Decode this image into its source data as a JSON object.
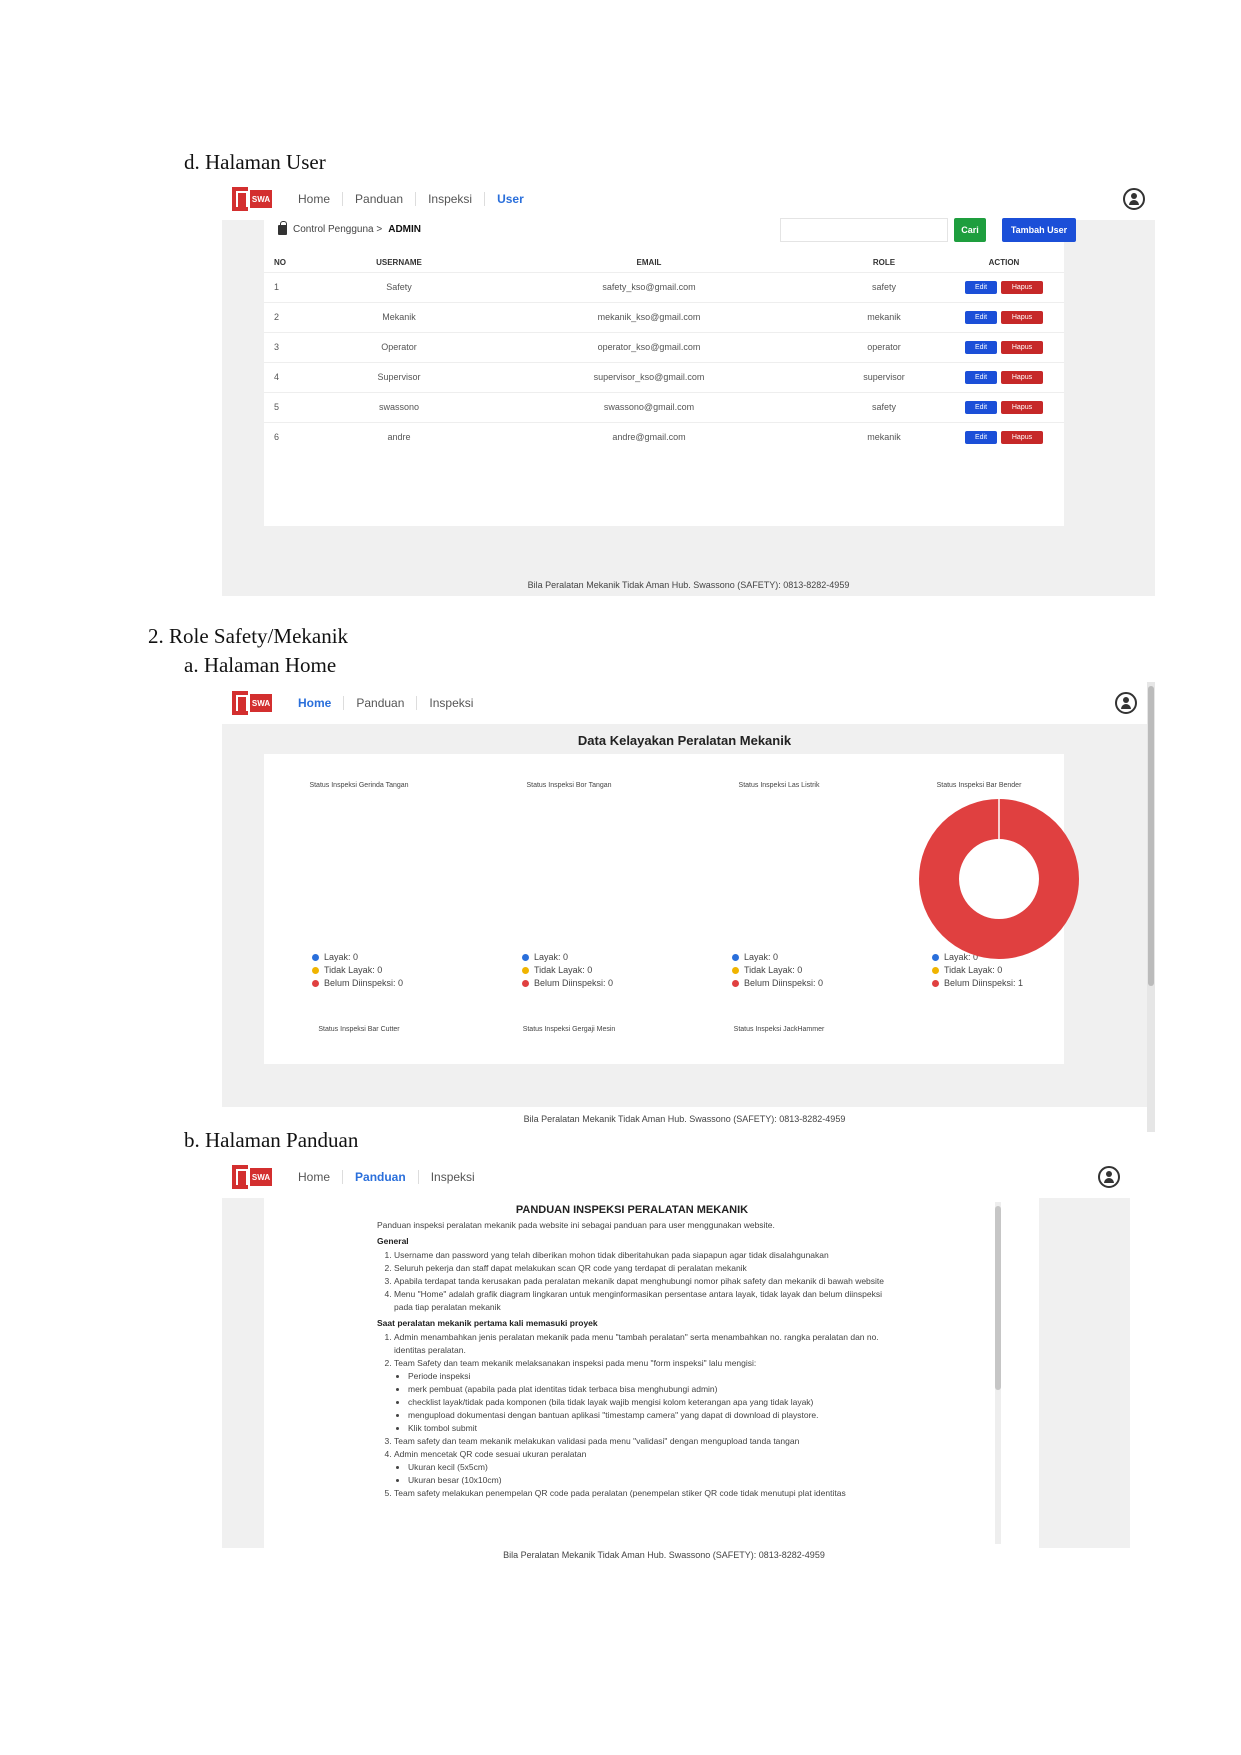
{
  "headings": {
    "d": "d.   Halaman User",
    "role": "2.   Role Safety/Mekanik",
    "a": "a.   Halaman Home",
    "b": "b.   Halaman Panduan"
  },
  "user_page": {
    "nav": [
      "Home",
      "Panduan",
      "Inspeksi",
      "User"
    ],
    "active": "User",
    "logo_text": "SWA",
    "breadcrumb_prefix": "Control Pengguna > ",
    "breadcrumb_current": "ADMIN",
    "search_placeholder": "",
    "cari_label": "Cari",
    "tambah_label": "Tambah User",
    "columns": [
      "NO",
      "USERNAME",
      "EMAIL",
      "ROLE",
      "ACTION"
    ],
    "edit_label": "Edit",
    "hapus_label": "Hapus",
    "rows": [
      {
        "no": "1",
        "username": "Safety",
        "email": "safety_kso@gmail.com",
        "role": "safety"
      },
      {
        "no": "2",
        "username": "Mekanik",
        "email": "mekanik_kso@gmail.com",
        "role": "mekanik"
      },
      {
        "no": "3",
        "username": "Operator",
        "email": "operator_kso@gmail.com",
        "role": "operator"
      },
      {
        "no": "4",
        "username": "Supervisor",
        "email": "supervisor_kso@gmail.com",
        "role": "supervisor"
      },
      {
        "no": "5",
        "username": "swassono",
        "email": "swassono@gmail.com",
        "role": "safety"
      },
      {
        "no": "6",
        "username": "andre",
        "email": "andre@gmail.com",
        "role": "mekanik"
      }
    ],
    "footer": "Bila Peralatan Mekanik Tidak Aman Hub. Swassono (SAFETY): 0813-8282-4959"
  },
  "home_page": {
    "nav": [
      "Home",
      "Panduan",
      "Inspeksi"
    ],
    "active": "Home",
    "title": "Data Kelayakan Peralatan Mekanik",
    "colors": {
      "layak": "#2a6fdb",
      "tidak_layak": "#f0b400",
      "belum": "#e04040"
    },
    "charts": [
      {
        "title": "Status Inspeksi Gerinda Tangan",
        "layak": "Layak: 0",
        "tidak": "Tidak Layak: 0",
        "belum": "Belum Diinspeksi: 0"
      },
      {
        "title": "Status Inspeksi Bor Tangan",
        "layak": "Layak: 0",
        "tidak": "Tidak Layak: 0",
        "belum": "Belum Diinspeksi: 0"
      },
      {
        "title": "Status Inspeksi Las Listrik",
        "layak": "Layak: 0",
        "tidak": "Tidak Layak: 0",
        "belum": "Belum Diinspeksi: 0"
      },
      {
        "title": "Status Inspeksi Bar Bender",
        "layak": "Layak: 0",
        "tidak": "Tidak Layak: 0",
        "belum": "Belum Diinspeksi: 1"
      }
    ],
    "charts_row2": [
      "Status Inspeksi Bar Cutter",
      "Status Inspeksi Gergaji Mesin",
      "Status Inspeksi JackHammer"
    ],
    "footer": "Bila Peralatan Mekanik Tidak Aman Hub. Swassono (SAFETY): 0813-8282-4959"
  },
  "panduan_page": {
    "nav": [
      "Home",
      "Panduan",
      "Inspeksi"
    ],
    "active": "Panduan",
    "title": "PANDUAN INSPEKSI PERALATAN MEKANIK",
    "intro": "Panduan inspeksi peralatan mekanik pada website ini sebagai panduan para user menggunakan website.",
    "general_heading": "General",
    "general": [
      "Username dan password yang telah diberikan mohon tidak diberitahukan pada siapapun agar tidak disalahgunakan",
      "Seluruh pekerja dan staff dapat melakukan scan QR code yang terdapat di peralatan mekanik",
      "Apabila terdapat tanda kerusakan pada peralatan mekanik dapat menghubungi nomor pihak safety dan mekanik di bawah website",
      "Menu \"Home\" adalah grafik diagram lingkaran untuk menginformasikan persentase antara layak, tidak layak dan belum diinspeksi pada tiap peralatan mekanik"
    ],
    "section2_heading": "Saat peralatan mekanik pertama kali memasuki proyek",
    "s2_1": "Admin menambahkan jenis peralatan mekanik pada menu \"tambah peralatan\" serta menambahkan no. rangka peralatan dan no. identitas peralatan.",
    "s2_2": "Team Safety dan team mekanik melaksanakan inspeksi pada menu \"form inspeksi\" lalu mengisi:",
    "s2_2_items": [
      "Periode inspeksi",
      "merk pembuat (apabila pada plat identitas tidak terbaca bisa menghubungi admin)",
      "checklist layak/tidak pada komponen (bila tidak layak wajib mengisi kolom keterangan apa yang tidak layak)",
      "mengupload dokumentasi dengan bantuan aplikasi \"timestamp camera\" yang dapat di download di playstore.",
      "Klik tombol submit"
    ],
    "s2_3": "Team safety dan team mekanik melakukan validasi pada menu \"validasi\" dengan mengupload tanda tangan",
    "s2_4": "Admin mencetak QR code sesuai ukuran peralatan",
    "s2_4_items": [
      "Ukuran kecil (5x5cm)",
      "Ukuran besar (10x10cm)"
    ],
    "s2_5": "Team safety melakukan penempelan QR code pada peralatan (penempelan stiker QR code tidak menutupi plat identitas",
    "footer": "Bila Peralatan Mekanik Tidak Aman Hub. Swassono (SAFETY): 0813-8282-4959"
  }
}
